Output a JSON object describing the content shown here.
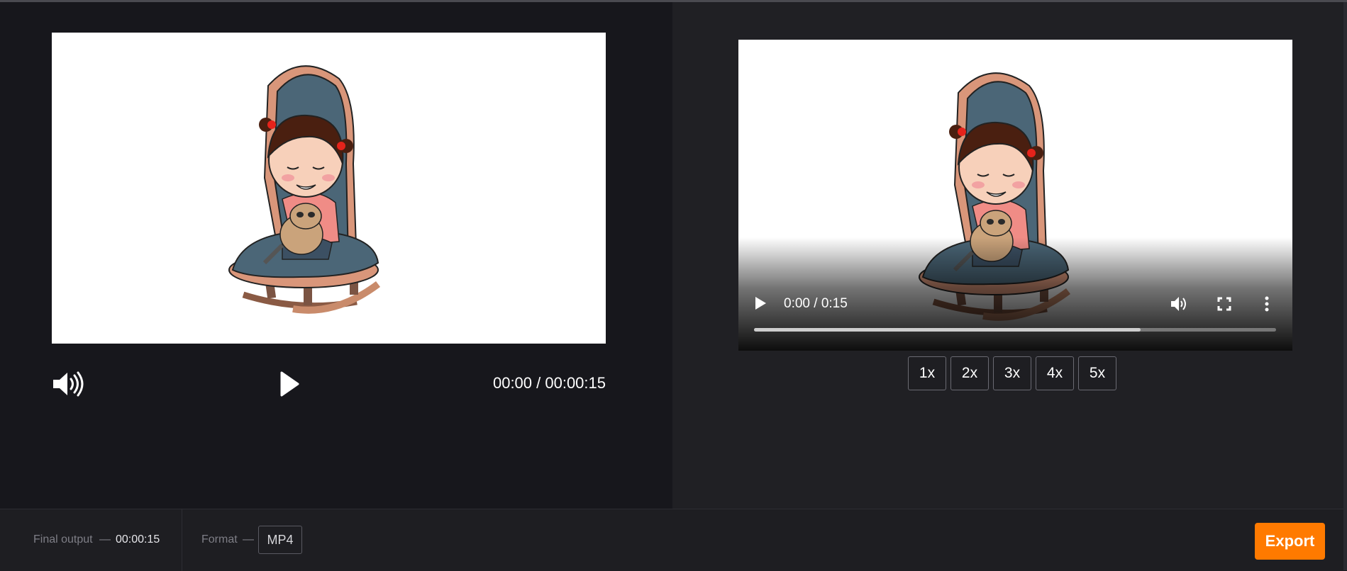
{
  "editor_preview": {
    "volume_icon": "volume-high-icon",
    "play_icon": "play-icon",
    "time_readout": "00:00 / 00:00:15"
  },
  "output_video": {
    "play_icon": "play-icon",
    "time": "0:00 / 0:15",
    "volume_icon": "volume-icon",
    "fullscreen_icon": "fullscreen-icon",
    "more_icon": "more-vertical-icon",
    "buffered_fraction": 0.74
  },
  "speed_options": [
    "1x",
    "2x",
    "3x",
    "4x",
    "5x"
  ],
  "footer": {
    "final_output_label": "Final output",
    "final_output_sep": "—",
    "final_output_value": "00:00:15",
    "format_label": "Format",
    "format_sep": "—",
    "format_value": "MP4",
    "export_label": "Export"
  },
  "colors": {
    "accent": "#ff7a00",
    "left_panel_bg": "#17171c",
    "right_panel_bg": "#202024"
  }
}
